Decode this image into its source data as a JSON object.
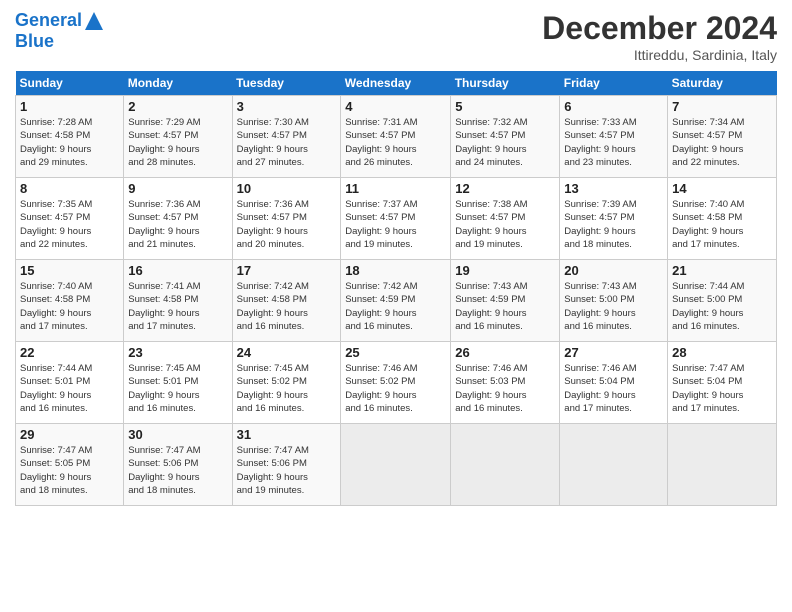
{
  "header": {
    "logo_line1": "General",
    "logo_line2": "Blue",
    "month": "December 2024",
    "location": "Ittireddu, Sardinia, Italy"
  },
  "weekdays": [
    "Sunday",
    "Monday",
    "Tuesday",
    "Wednesday",
    "Thursday",
    "Friday",
    "Saturday"
  ],
  "weeks": [
    [
      {
        "day": "1",
        "detail": "Sunrise: 7:28 AM\nSunset: 4:58 PM\nDaylight: 9 hours\nand 29 minutes."
      },
      {
        "day": "2",
        "detail": "Sunrise: 7:29 AM\nSunset: 4:57 PM\nDaylight: 9 hours\nand 28 minutes."
      },
      {
        "day": "3",
        "detail": "Sunrise: 7:30 AM\nSunset: 4:57 PM\nDaylight: 9 hours\nand 27 minutes."
      },
      {
        "day": "4",
        "detail": "Sunrise: 7:31 AM\nSunset: 4:57 PM\nDaylight: 9 hours\nand 26 minutes."
      },
      {
        "day": "5",
        "detail": "Sunrise: 7:32 AM\nSunset: 4:57 PM\nDaylight: 9 hours\nand 24 minutes."
      },
      {
        "day": "6",
        "detail": "Sunrise: 7:33 AM\nSunset: 4:57 PM\nDaylight: 9 hours\nand 23 minutes."
      },
      {
        "day": "7",
        "detail": "Sunrise: 7:34 AM\nSunset: 4:57 PM\nDaylight: 9 hours\nand 22 minutes."
      }
    ],
    [
      {
        "day": "8",
        "detail": "Sunrise: 7:35 AM\nSunset: 4:57 PM\nDaylight: 9 hours\nand 22 minutes."
      },
      {
        "day": "9",
        "detail": "Sunrise: 7:36 AM\nSunset: 4:57 PM\nDaylight: 9 hours\nand 21 minutes."
      },
      {
        "day": "10",
        "detail": "Sunrise: 7:36 AM\nSunset: 4:57 PM\nDaylight: 9 hours\nand 20 minutes."
      },
      {
        "day": "11",
        "detail": "Sunrise: 7:37 AM\nSunset: 4:57 PM\nDaylight: 9 hours\nand 19 minutes."
      },
      {
        "day": "12",
        "detail": "Sunrise: 7:38 AM\nSunset: 4:57 PM\nDaylight: 9 hours\nand 19 minutes."
      },
      {
        "day": "13",
        "detail": "Sunrise: 7:39 AM\nSunset: 4:57 PM\nDaylight: 9 hours\nand 18 minutes."
      },
      {
        "day": "14",
        "detail": "Sunrise: 7:40 AM\nSunset: 4:58 PM\nDaylight: 9 hours\nand 17 minutes."
      }
    ],
    [
      {
        "day": "15",
        "detail": "Sunrise: 7:40 AM\nSunset: 4:58 PM\nDaylight: 9 hours\nand 17 minutes."
      },
      {
        "day": "16",
        "detail": "Sunrise: 7:41 AM\nSunset: 4:58 PM\nDaylight: 9 hours\nand 17 minutes."
      },
      {
        "day": "17",
        "detail": "Sunrise: 7:42 AM\nSunset: 4:58 PM\nDaylight: 9 hours\nand 16 minutes."
      },
      {
        "day": "18",
        "detail": "Sunrise: 7:42 AM\nSunset: 4:59 PM\nDaylight: 9 hours\nand 16 minutes."
      },
      {
        "day": "19",
        "detail": "Sunrise: 7:43 AM\nSunset: 4:59 PM\nDaylight: 9 hours\nand 16 minutes."
      },
      {
        "day": "20",
        "detail": "Sunrise: 7:43 AM\nSunset: 5:00 PM\nDaylight: 9 hours\nand 16 minutes."
      },
      {
        "day": "21",
        "detail": "Sunrise: 7:44 AM\nSunset: 5:00 PM\nDaylight: 9 hours\nand 16 minutes."
      }
    ],
    [
      {
        "day": "22",
        "detail": "Sunrise: 7:44 AM\nSunset: 5:01 PM\nDaylight: 9 hours\nand 16 minutes."
      },
      {
        "day": "23",
        "detail": "Sunrise: 7:45 AM\nSunset: 5:01 PM\nDaylight: 9 hours\nand 16 minutes."
      },
      {
        "day": "24",
        "detail": "Sunrise: 7:45 AM\nSunset: 5:02 PM\nDaylight: 9 hours\nand 16 minutes."
      },
      {
        "day": "25",
        "detail": "Sunrise: 7:46 AM\nSunset: 5:02 PM\nDaylight: 9 hours\nand 16 minutes."
      },
      {
        "day": "26",
        "detail": "Sunrise: 7:46 AM\nSunset: 5:03 PM\nDaylight: 9 hours\nand 16 minutes."
      },
      {
        "day": "27",
        "detail": "Sunrise: 7:46 AM\nSunset: 5:04 PM\nDaylight: 9 hours\nand 17 minutes."
      },
      {
        "day": "28",
        "detail": "Sunrise: 7:47 AM\nSunset: 5:04 PM\nDaylight: 9 hours\nand 17 minutes."
      }
    ],
    [
      {
        "day": "29",
        "detail": "Sunrise: 7:47 AM\nSunset: 5:05 PM\nDaylight: 9 hours\nand 18 minutes."
      },
      {
        "day": "30",
        "detail": "Sunrise: 7:47 AM\nSunset: 5:06 PM\nDaylight: 9 hours\nand 18 minutes."
      },
      {
        "day": "31",
        "detail": "Sunrise: 7:47 AM\nSunset: 5:06 PM\nDaylight: 9 hours\nand 19 minutes."
      },
      {
        "day": "",
        "detail": ""
      },
      {
        "day": "",
        "detail": ""
      },
      {
        "day": "",
        "detail": ""
      },
      {
        "day": "",
        "detail": ""
      }
    ]
  ]
}
